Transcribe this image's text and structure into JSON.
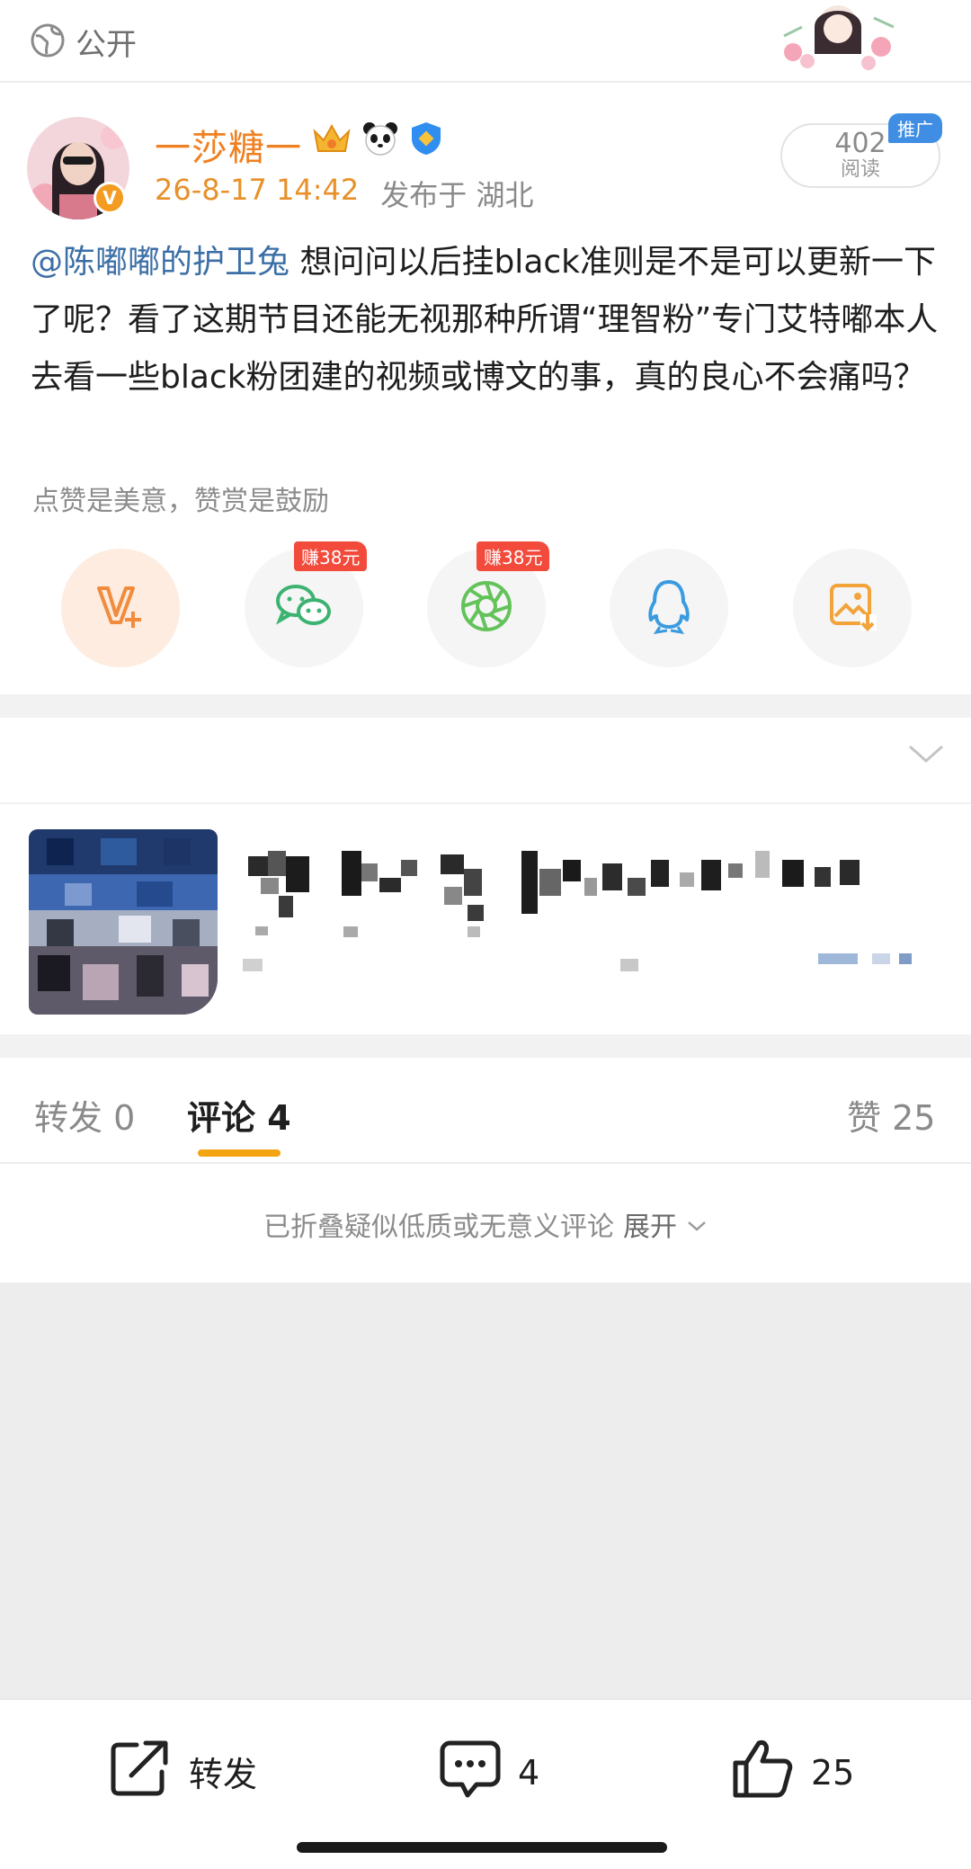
{
  "topbar": {
    "privacy_label": "公开"
  },
  "post": {
    "username": "一莎糖一",
    "time": "26-8-17 14:42",
    "location": "发布于 湖北",
    "reads": {
      "count": "402",
      "label": "阅读"
    },
    "promo_tag": "推广",
    "mention": "@陈嘟嘟的护卫兔",
    "text": " 想问问以后挂black准则是不是可以更新一下了呢？看了这期节目还能无视那种所谓“理智粉”专门艾特嘟本人去看一些black粉团建的视频或博文的事，真的良心不会痛吗？",
    "reward_tip": "点赞是美意，赞赏是鼓励"
  },
  "share": {
    "earn_tag_1": "赚38元",
    "earn_tag_2": "赚38元"
  },
  "tabs": {
    "repost": "转发 0",
    "comment": "评论 4",
    "like": "赞 25"
  },
  "fold_note": {
    "text": "已折叠疑似低质或无意义评论",
    "expand": "展开"
  },
  "bottom": {
    "repost": "转发",
    "comment_count": "4",
    "like_count": "25"
  },
  "colors": {
    "accent_orange": "#f08020",
    "mention_blue": "#3c6fa6",
    "underline": "#f2a413",
    "earn_red": "#f24a3b"
  }
}
